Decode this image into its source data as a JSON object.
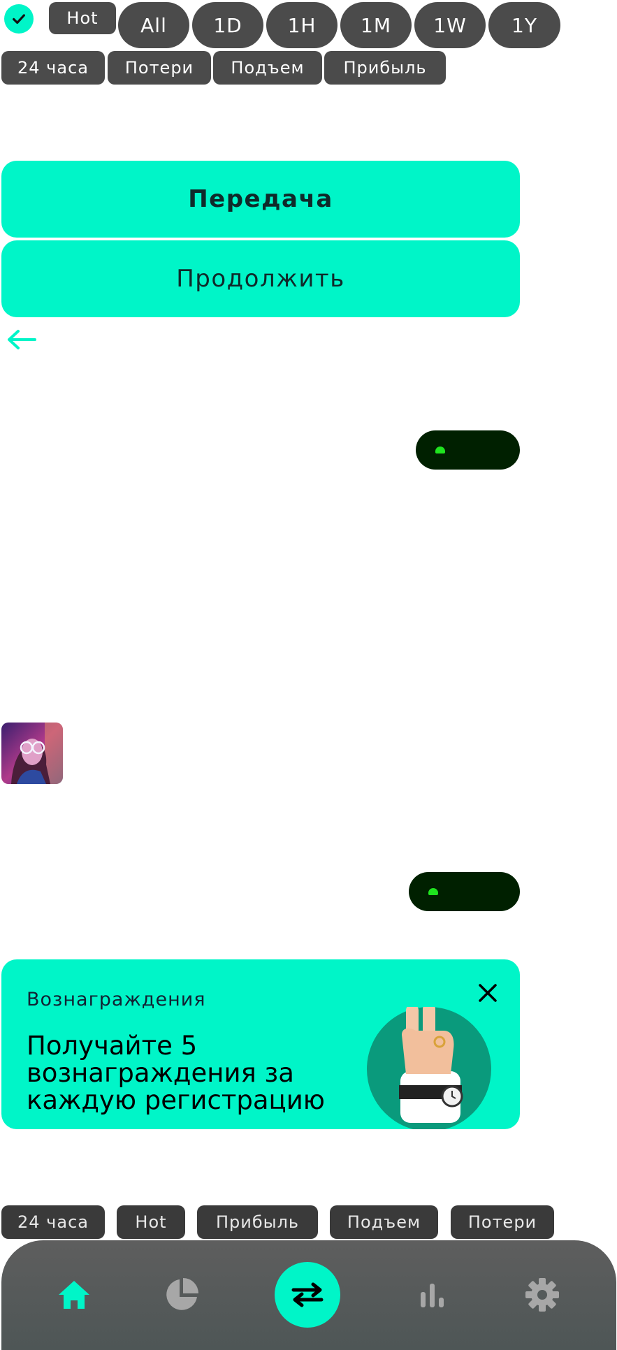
{
  "filters_top": {
    "hot_label": "Hot",
    "periods": [
      "All",
      "1D",
      "1H",
      "1M",
      "1W",
      "1Y"
    ]
  },
  "filters_row2": [
    "24 часа",
    "Потери",
    "Подъем",
    "Прибыль"
  ],
  "buttons": {
    "transfer_label": "Передача",
    "continue_label": "Продолжить"
  },
  "banner": {
    "label": "Вознаграждения",
    "text": "Получайте 5 вознаграждения за каждую регистрацию"
  },
  "filters_bottom": [
    "24 часа",
    "Hot",
    "Прибыль",
    "Подъем",
    "Потери"
  ],
  "nav": {
    "items": [
      "home-icon",
      "pie-chart-icon",
      "swap-icon",
      "bar-chart-icon",
      "gear-icon"
    ],
    "active": "home-icon"
  },
  "colors": {
    "accent": "#00f5c8",
    "chip": "#4b4b4b",
    "positive": "#1fe31f"
  }
}
